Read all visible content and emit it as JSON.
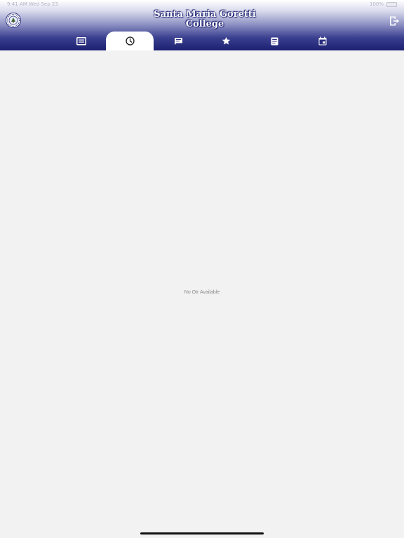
{
  "status_bar": {
    "left": "9:41 AM Wed Sep 23",
    "right": "100%"
  },
  "header": {
    "title_line1": "Santa Maria Goretti",
    "title_line2": "College"
  },
  "tabs": [
    {
      "icon": "announcement-icon",
      "active": false
    },
    {
      "icon": "clock-icon",
      "active": true
    },
    {
      "icon": "message-icon",
      "active": false
    },
    {
      "icon": "star-icon",
      "active": false
    },
    {
      "icon": "document-icon",
      "active": false
    },
    {
      "icon": "calendar-icon",
      "active": false
    }
  ],
  "main": {
    "empty_message": "No Otr Available"
  },
  "colors": {
    "header_dark": "#1c2070",
    "background": "#f2f2f2",
    "icon_color": "#ffffff",
    "active_icon_color": "#1a1a1a"
  }
}
